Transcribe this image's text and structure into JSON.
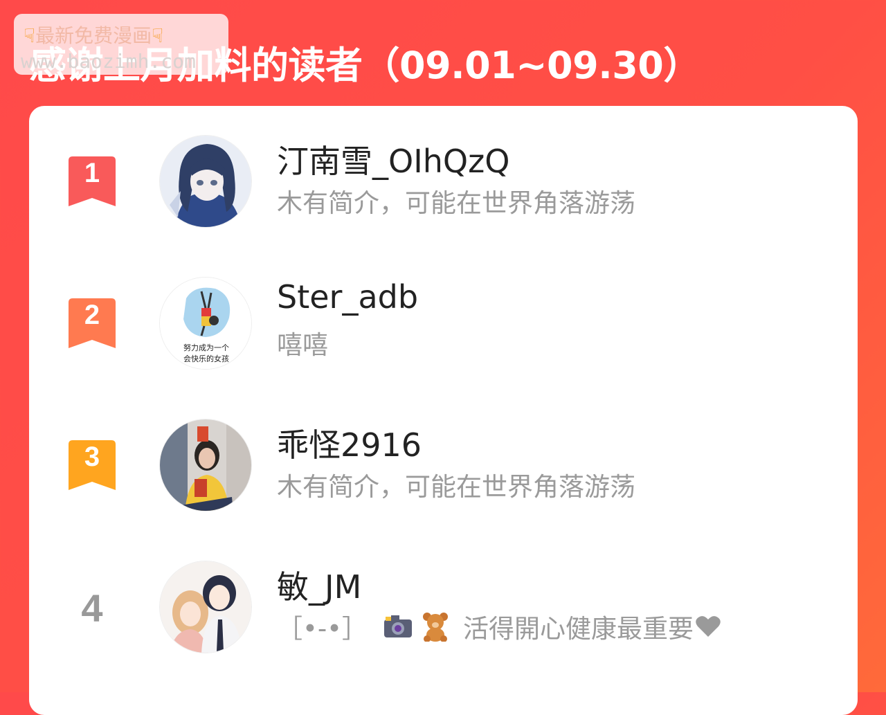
{
  "header": {
    "title": "感谢上月加料的读者（09.01~09.30）"
  },
  "watermark": {
    "line1": "最新免费漫画",
    "line2": "www.baozimh.com",
    "hand_icon": "pointing-down-hand-icon"
  },
  "colors": {
    "background": "#ff4a4a",
    "rank1": "#f95a5a",
    "rank2": "#ff7a50",
    "rank3": "#ffa51f",
    "rank_plain": "#999999",
    "name": "#222222",
    "bio": "#9a9a9a"
  },
  "readers": [
    {
      "rank": "1",
      "name": "汀南雪_OIhQzQ",
      "bio": "木有简介，可能在世界角落游荡",
      "avatar_icon": "anime-girl-avatar-icon"
    },
    {
      "rank": "2",
      "name": "Ster_adb",
      "bio": "嘻嘻",
      "avatar_icon": "doodle-girl-avatar-icon",
      "avatar_caption_1": "努力成为一个",
      "avatar_caption_2": "会快乐的女孩"
    },
    {
      "rank": "3",
      "name": "乖怪2916",
      "bio": "木有简介，可能在世界角落游荡",
      "avatar_icon": "selfie-photo-avatar-icon"
    },
    {
      "rank": "4",
      "name": "敏_JM",
      "bio_prefix": "［•-•］",
      "bio_icons": [
        "camera-icon",
        "teddy-bear-icon"
      ],
      "bio_text": "活得開心健康最重要",
      "bio_suffix_icon": "heart-icon"
    }
  ]
}
